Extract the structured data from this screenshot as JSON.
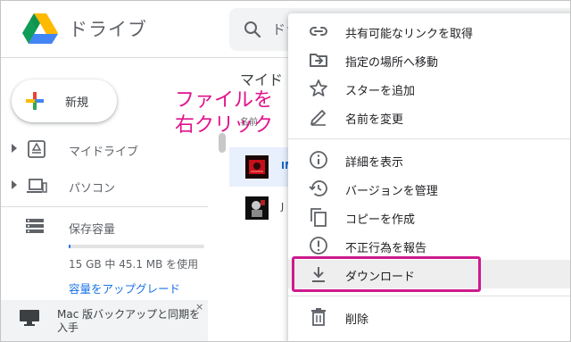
{
  "header": {
    "app_title": "ドライブ",
    "search_text": "ドライブで検索"
  },
  "sidebar": {
    "new_button": "新規",
    "items": [
      {
        "label": "マイドライブ",
        "icon": "my-drive-icon"
      },
      {
        "label": "パソコン",
        "icon": "computers-icon"
      }
    ],
    "storage": {
      "title": "保存容量",
      "usage": "15 GB 中 45.1 MB を使用",
      "used_fraction": 0.003,
      "upgrade": "容量をアップグレード"
    },
    "banner": {
      "text": "Mac 版バックアップと同期を入手",
      "close": "×"
    }
  },
  "main": {
    "breadcrumb": "マイド",
    "column_header": "名前",
    "files": [
      {
        "name": "IM",
        "selected": true
      },
      {
        "name": "J",
        "selected": false
      }
    ]
  },
  "annotation": {
    "line1": "ファイルを",
    "line2": "右クリック"
  },
  "context_menu": {
    "groups": [
      [
        {
          "label": "共有可能なリンクを取得",
          "icon": "link-icon"
        },
        {
          "label": "指定の場所へ移動",
          "icon": "move-to-folder-icon"
        },
        {
          "label": "スターを追加",
          "icon": "star-icon"
        },
        {
          "label": "名前を変更",
          "icon": "pencil-icon"
        }
      ],
      [
        {
          "label": "詳細を表示",
          "icon": "info-icon"
        },
        {
          "label": "バージョンを管理",
          "icon": "history-icon"
        },
        {
          "label": "コピーを作成",
          "icon": "copy-icon"
        },
        {
          "label": "不正行為を報告",
          "icon": "report-icon"
        },
        {
          "label": "ダウンロード",
          "icon": "download-icon",
          "highlighted": true
        }
      ],
      [
        {
          "label": "削除",
          "icon": "trash-icon"
        }
      ]
    ]
  },
  "colors": {
    "accent": "#1a73e8",
    "annotation": "#e0138c",
    "highlight_border": "#cc1b8e"
  }
}
